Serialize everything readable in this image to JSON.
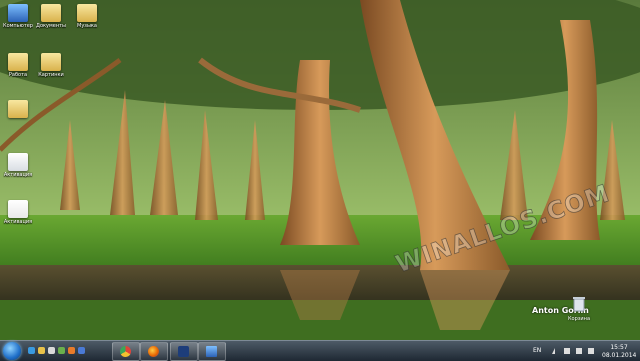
{
  "desktop": {
    "icons": [
      {
        "label": "Компьютер",
        "icon": "computer-icon"
      },
      {
        "label": "Документы",
        "icon": "documents-folder-icon"
      },
      {
        "label": "Музыка",
        "icon": "music-folder-icon"
      },
      {
        "label": "Работа",
        "icon": "folder-icon"
      },
      {
        "label": "Картинки",
        "icon": "pictures-folder-icon"
      },
      {
        "label": "",
        "icon": "folder-icon"
      },
      {
        "label": "Активация",
        "icon": "document-icon"
      },
      {
        "label": "Активация",
        "icon": "text-file-icon"
      }
    ],
    "recycle_bin_label": "Корзина",
    "owner_name": "Anton Gorlin",
    "watermark": "WINALLOS.COM"
  },
  "taskbar": {
    "pinned_apps": [
      {
        "icon": "chrome-icon",
        "color": "#e0443a"
      },
      {
        "icon": "firefox-icon",
        "color": "#e66000"
      },
      {
        "icon": "photoshop-icon",
        "color": "#2a6ad1"
      },
      {
        "icon": "display-icon",
        "color": "#3a8fd6"
      }
    ],
    "tray": {
      "language": "EN",
      "time": "15:57",
      "date": "08.01.2014"
    }
  }
}
